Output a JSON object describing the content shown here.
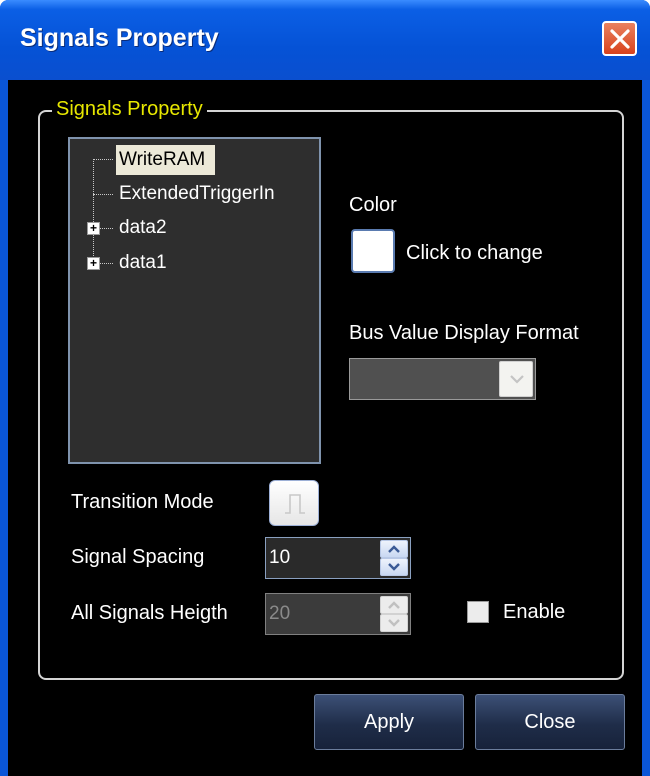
{
  "window": {
    "title": "Signals Property"
  },
  "group": {
    "legend": "Signals Property"
  },
  "tree": {
    "items": [
      {
        "label": "WriteRAM",
        "selected": true,
        "expandable": false
      },
      {
        "label": "ExtendedTriggerIn",
        "selected": false,
        "expandable": false
      },
      {
        "label": "data2",
        "selected": false,
        "expandable": true
      },
      {
        "label": "data1",
        "selected": false,
        "expandable": true
      }
    ]
  },
  "color": {
    "label": "Color",
    "hint": "Click to change",
    "value": "#ffffff"
  },
  "bus_format": {
    "label": "Bus Value Display Format",
    "selected": ""
  },
  "transition_mode": {
    "label": "Transition Mode"
  },
  "signal_spacing": {
    "label": "Signal Spacing",
    "value": "10"
  },
  "all_signals_height": {
    "label": "All Signals Heigth",
    "value": "20",
    "enabled": false
  },
  "enable": {
    "label": "Enable",
    "checked": false
  },
  "buttons": {
    "apply": "Apply",
    "close": "Close"
  },
  "colors": {
    "title_bar": "#0552d6",
    "legend": "#e8e800",
    "client_bg": "#000000"
  },
  "icons": {
    "close": "close-icon",
    "expand": "plus-icon",
    "dropdown": "chevron-down-icon",
    "transition": "transition-icon",
    "spin_up": "arrow-up-icon",
    "spin_down": "arrow-down-icon"
  }
}
